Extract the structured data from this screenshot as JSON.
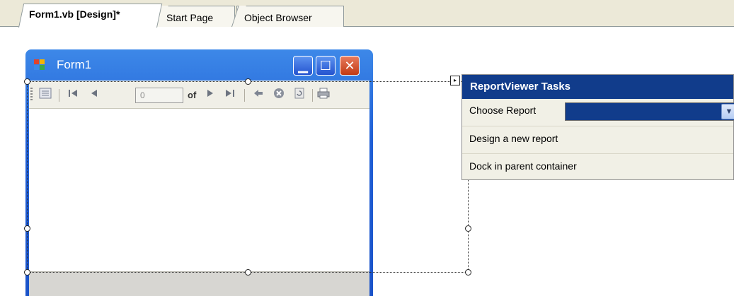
{
  "tabs": [
    {
      "label": "Form1.vb [Design]*",
      "active": true
    },
    {
      "label": "Start Page",
      "active": false
    },
    {
      "label": "Object Browser",
      "active": false
    }
  ],
  "form": {
    "title": "Form1",
    "icon": "form-icon",
    "caption_buttons": {
      "minimize": "▁",
      "maximize": "☐",
      "close": "✕"
    },
    "accent_color": "#1f5fd6"
  },
  "report_toolbar": {
    "page_value": "0",
    "of_label": "of",
    "icons": [
      "parameters-icon",
      "first-page-icon",
      "previous-page-icon",
      "next-page-icon",
      "last-page-icon",
      "back-icon",
      "stop-icon",
      "refresh-icon",
      "print-icon"
    ]
  },
  "tasks_panel": {
    "header": "ReportViewer Tasks",
    "choose_report_label": "Choose Report",
    "choose_report_value": "",
    "design_new_report": "Design a new report",
    "dock_in_parent": "Dock in parent container",
    "header_color": "#113c8b"
  }
}
